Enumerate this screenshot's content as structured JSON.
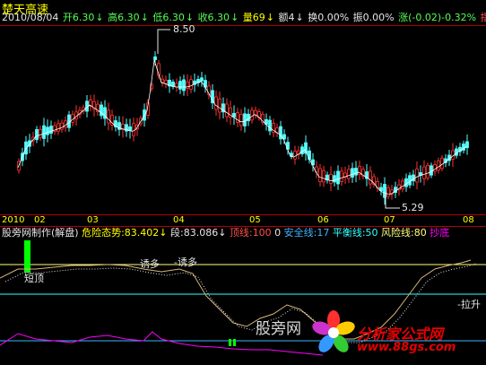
{
  "stock": {
    "name": "楚天高速"
  },
  "quote": {
    "date": "2010/08/04",
    "open": "开6.30",
    "high": "高6.30",
    "low": "低6.30",
    "close": "收6.30",
    "volume": "量69",
    "amount": "额4",
    "turnover": "换0.00%",
    "amplitude": "振0.00%",
    "change": "涨(-0.02)-0.32%",
    "indicator_menu": "指数"
  },
  "price_chart": {
    "max_label": "8.50",
    "min_label": "5.29"
  },
  "date_axis": {
    "labels": [
      "2010",
      "02",
      "03",
      "04",
      "05",
      "06",
      "07",
      "08"
    ]
  },
  "indicator": {
    "name": "股旁网制作(解盘)",
    "risk": "危险态势:83.402",
    "segment": "段:83.086",
    "top_line": "顶线:100",
    "zero": "0",
    "safe_line": "安全线:17",
    "balance_line": "平衡线:50",
    "risk_line": "风险线:80",
    "bottom_label": "抄底"
  },
  "annotations": {
    "short_top": "短顶",
    "lure1": "诱多",
    "lure2": "诱多",
    "pull_up": "拉升"
  },
  "watermark": {
    "text": "股旁网",
    "logo": "分析家公式网",
    "url": "www.88gs.com"
  },
  "colors": {
    "up": "#ff3232",
    "down": "#54ffff",
    "axis": "#b00000",
    "ma": "#ffffff",
    "ma2": "#ffff00",
    "pink": "#ff00ff",
    "green": "#00ff00"
  }
}
